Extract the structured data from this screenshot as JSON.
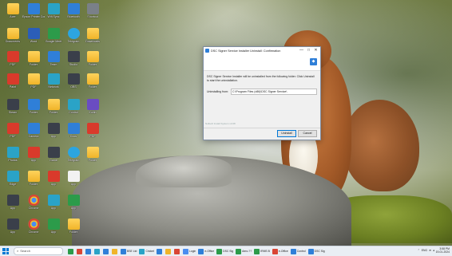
{
  "desktop": {
    "icons": [
      {
        "label": "Acer",
        "icon": "folder-icon",
        "style": "folder",
        "col": 0,
        "row": 0
      },
      {
        "label": "Epson Printer Connect...",
        "icon": "epson-icon",
        "style": "blue",
        "col": 1,
        "row": 0
      },
      {
        "label": "Wifi Sync",
        "icon": "wifi-icon",
        "style": "teal",
        "col": 2,
        "row": 0
      },
      {
        "label": "Bluetooth",
        "icon": "bluetooth-icon",
        "style": "blue",
        "col": 3,
        "row": 0
      },
      {
        "label": "Shortcut",
        "icon": "shortcut-icon",
        "style": "gray",
        "col": 4,
        "row": 0
      },
      {
        "label": "Documents",
        "icon": "folder-icon",
        "style": "folder",
        "col": 0,
        "row": 1
      },
      {
        "label": "Word",
        "icon": "word-icon",
        "style": "word",
        "col": 1,
        "row": 1
      },
      {
        "label": "Google Meet",
        "icon": "meet-icon",
        "style": "green",
        "col": 2,
        "row": 1
      },
      {
        "label": "Telegram",
        "icon": "telegram-icon",
        "style": "tg",
        "col": 3,
        "row": 1
      },
      {
        "label": "Downloads",
        "icon": "folder-icon",
        "style": "folder",
        "col": 4,
        "row": 1
      },
      {
        "label": "PDF",
        "icon": "pdf-icon",
        "style": "pdf",
        "col": 0,
        "row": 2
      },
      {
        "label": "Folder",
        "icon": "folder-icon",
        "style": "folder",
        "col": 1,
        "row": 2
      },
      {
        "label": "Team",
        "icon": "team-icon",
        "style": "blue",
        "col": 2,
        "row": 2
      },
      {
        "label": "Studio",
        "icon": "studio-icon",
        "style": "dark",
        "col": 3,
        "row": 2
      },
      {
        "label": "Folder",
        "icon": "folder-icon",
        "style": "folder",
        "col": 4,
        "row": 2
      },
      {
        "label": "Paint",
        "icon": "brush-icon",
        "style": "pdf",
        "col": 0,
        "row": 3
      },
      {
        "label": "PDF",
        "icon": "pdf-icon",
        "style": "folder",
        "col": 1,
        "row": 3
      },
      {
        "label": "Network",
        "icon": "network-icon",
        "style": "teal",
        "col": 2,
        "row": 3
      },
      {
        "label": "OBS",
        "icon": "obs-icon",
        "style": "dark",
        "col": 3,
        "row": 3
      },
      {
        "label": "Folder",
        "icon": "folder-icon",
        "style": "folder",
        "col": 4,
        "row": 3
      },
      {
        "label": "Steam",
        "icon": "steam-icon",
        "style": "dark",
        "col": 0,
        "row": 4
      },
      {
        "label": "Folder",
        "icon": "folder-icon",
        "style": "blue",
        "col": 1,
        "row": 4
      },
      {
        "label": "Folder",
        "icon": "folder-icon",
        "style": "folder",
        "col": 2,
        "row": 4
      },
      {
        "label": "Control",
        "icon": "control-icon",
        "style": "teal",
        "col": 3,
        "row": 4
      },
      {
        "label": "Kotlin",
        "icon": "kotlin-icon",
        "style": "purple",
        "col": 4,
        "row": 4
      },
      {
        "label": "PDF",
        "icon": "pdf-icon",
        "style": "pdf",
        "col": 0,
        "row": 5
      },
      {
        "label": "Camera",
        "icon": "camera-icon",
        "style": "blue",
        "col": 1,
        "row": 5
      },
      {
        "label": "App",
        "icon": "app-icon",
        "style": "dark",
        "col": 2,
        "row": 5
      },
      {
        "label": "Docs",
        "icon": "docs-icon",
        "style": "blue",
        "col": 3,
        "row": 5
      },
      {
        "label": "PDF",
        "icon": "pdf-icon",
        "style": "pdf",
        "col": 4,
        "row": 5
      },
      {
        "label": "Photos",
        "icon": "photos-icon",
        "style": "teal",
        "col": 0,
        "row": 6
      },
      {
        "label": "App",
        "icon": "app-icon",
        "style": "pdf",
        "col": 1,
        "row": 6
      },
      {
        "label": "Game",
        "icon": "game-icon",
        "style": "dark",
        "col": 2,
        "row": 6
      },
      {
        "label": "Telegram",
        "icon": "telegram-icon",
        "style": "tg",
        "col": 3,
        "row": 6
      },
      {
        "label": "Folder",
        "icon": "folder-icon",
        "style": "folder",
        "col": 4,
        "row": 6
      },
      {
        "label": "Edge",
        "icon": "edge-icon",
        "style": "teal",
        "col": 0,
        "row": 7
      },
      {
        "label": "Folder",
        "icon": "folder-icon",
        "style": "folder",
        "col": 1,
        "row": 7
      },
      {
        "label": "App",
        "icon": "app-icon",
        "style": "pdf",
        "col": 2,
        "row": 7
      },
      {
        "label": "App",
        "icon": "app-icon",
        "style": "white",
        "col": 3,
        "row": 7
      },
      {
        "label": "App",
        "icon": "app-icon",
        "style": "dark",
        "col": 0,
        "row": 8
      },
      {
        "label": "Chrome",
        "icon": "chrome-icon",
        "style": "chrome",
        "col": 1,
        "row": 8
      },
      {
        "label": "App",
        "icon": "app-icon",
        "style": "teal",
        "col": 2,
        "row": 8
      },
      {
        "label": "App",
        "icon": "app-icon",
        "style": "green",
        "col": 3,
        "row": 8
      },
      {
        "label": "App",
        "icon": "app-icon",
        "style": "dark",
        "col": 0,
        "row": 9
      },
      {
        "label": "Chrome",
        "icon": "chrome-icon",
        "style": "chrome",
        "col": 1,
        "row": 9
      },
      {
        "label": "App",
        "icon": "app-icon",
        "style": "green",
        "col": 2,
        "row": 9
      },
      {
        "label": "Folder",
        "icon": "folder-icon",
        "style": "folder",
        "col": 3,
        "row": 9
      }
    ]
  },
  "dialog": {
    "title": "DSC Signer Service Installer Uninstall: Confirmation",
    "message": "DSC Signer Service Installer will be uninstalled from the following folder. Click Uninstall to start the uninstallation.",
    "uninstall_from_label": "Uninstalling from:",
    "uninstall_from_path": "C:\\Program Files (x86)\\DSC Signer Service\\",
    "brand_text": "Nullsoft Install System v3.08",
    "uninstall_button": "Uninstall",
    "cancel_button": "Cancel",
    "window_controls": {
      "minimize": "—",
      "maximize": "□",
      "close": "✕"
    }
  },
  "taskbar": {
    "search_placeholder": "Search",
    "apps": [
      {
        "label": "",
        "color": "#2c9b4a"
      },
      {
        "label": "",
        "color": "#d94535"
      },
      {
        "label": "",
        "color": "#2f7fd8"
      },
      {
        "label": "",
        "color": "#2aa3c7"
      },
      {
        "label": "",
        "color": "#2f7fd8"
      },
      {
        "label": "",
        "color": "#f0b429"
      },
      {
        "label": "BSE Ltd",
        "color": "#2f7fd8"
      },
      {
        "label": "Cricket",
        "color": "#2aa3c7"
      },
      {
        "label": "",
        "color": "#2f7fd8"
      },
      {
        "label": "",
        "color": "#f0b429"
      },
      {
        "label": "",
        "color": "#d94535"
      },
      {
        "label": "Login",
        "color": "#4a8df0"
      },
      {
        "label": "e-Office",
        "color": "#2f7fd8"
      },
      {
        "label": "DSC Sig",
        "color": "#2c9b4a"
      },
      {
        "label": "Aero-??",
        "color": "#2c9b4a"
      },
      {
        "label": "IRMS B",
        "color": "#2c9b4a"
      },
      {
        "label": "e-Office",
        "color": "#d94535"
      },
      {
        "label": "Control",
        "color": "#2f7fd8"
      },
      {
        "label": "DSC Sig",
        "color": "#2f7fd8"
      }
    ],
    "tray": {
      "language": "ENG",
      "region": "IN",
      "time": "3:58 PM",
      "date": "19-01-2024"
    }
  }
}
